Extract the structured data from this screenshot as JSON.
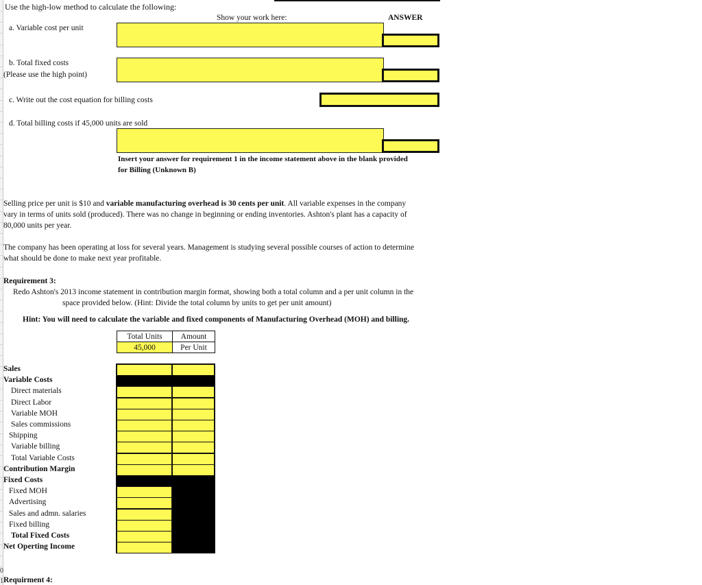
{
  "intro": {
    "title": "Use the high-low method to calculate the following:",
    "show_work_label": "Show your work here:",
    "answer_label": "ANSWER"
  },
  "questions": [
    {
      "id": "a",
      "label": "a.  Variable cost per unit"
    },
    {
      "id": "b",
      "label": "b.  Total fixed costs",
      "sublabel": "(Please use the high point)"
    },
    {
      "id": "c",
      "label": "c.  Write out the cost equation for billing costs"
    },
    {
      "id": "d",
      "label": "d.  Total billing costs if 45,000 units are sold"
    }
  ],
  "insert_note": {
    "line1": "Insert your answer for requirement 1 in the income statement above in the blank provided",
    "line2": "for Billing  (Unknown B)"
  },
  "facts": {
    "p1_line1_pre": "Selling price per unit is $10 and ",
    "p1_line1_bold": "variable manufacturing overhead is 30 cents per unit",
    "p1_line1_post": ".  All variable expenses in the company",
    "p1_line2": "vary in terms of units sold (produced).  There was no change in beginning or ending inventories.  Ashton's plant has a capacity of",
    "p1_line3": "80,000 units  per year.",
    "p2_line1": "The company has been operating at loss for several years.  Management is studying several possible courses of action to determine",
    "p2_line2": "what should be done to make next year profitable."
  },
  "requirement3": {
    "title": "Requirement 3:",
    "line1": "Redo Ashton's 2013  income statement in contribution margin format, showing both a total column and a per unit column in the",
    "line2": "space provided below.  (Hint:  Divide the total column by units to get per unit amount)",
    "hint": "Hint:  You will need to calculate the variable and fixed components of Manufacturing Overhead (MOH) and billing."
  },
  "header_table": {
    "col1_top": "Total Units",
    "col1_value": "45,000",
    "col2_top": "Amount",
    "col2_bottom": "Per Unit"
  },
  "income_statement": {
    "rows": [
      {
        "label": "Sales",
        "bold": true,
        "type": "both"
      },
      {
        "label": "Variable Costs",
        "bold": true,
        "type": "black"
      },
      {
        "label": "Direct materials",
        "indent": 2,
        "type": "both"
      },
      {
        "label": "Direct Labor",
        "indent": 2,
        "type": "both"
      },
      {
        "label": "Variable MOH",
        "indent": 2,
        "type": "both"
      },
      {
        "label": "Sales commissions",
        "indent": 2,
        "type": "both"
      },
      {
        "label": "Shipping",
        "indent": 1,
        "type": "both"
      },
      {
        "label": "Variable billing",
        "indent": 2,
        "type": "both"
      },
      {
        "label": "Total Variable Costs",
        "indent": 2,
        "type": "both"
      },
      {
        "label": "Contribution Margin",
        "bold": true,
        "type": "both"
      },
      {
        "label": "Fixed Costs",
        "bold": true,
        "type": "black"
      },
      {
        "label": "Fixed MOH",
        "indent": 1,
        "type": "total-only"
      },
      {
        "label": "Advertising",
        "indent": 1,
        "type": "total-only"
      },
      {
        "label": "Sales and admn. salaries",
        "indent": 1,
        "type": "total-only"
      },
      {
        "label": "Fixed billing",
        "indent": 1,
        "type": "total-only"
      },
      {
        "label": "Total Fixed Costs",
        "indent": 2,
        "bold": true,
        "type": "total-only"
      },
      {
        "label": "Net Operting Income",
        "bold": true,
        "type": "total-only"
      }
    ]
  },
  "requirement4": {
    "title": "Requirment 4:"
  },
  "colors": {
    "input_yellow": "#fefa55",
    "border": "#111111"
  }
}
